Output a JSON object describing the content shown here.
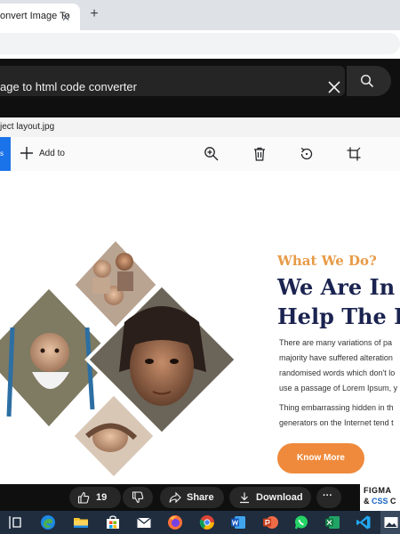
{
  "browser": {
    "tab_title": "onvert Image To",
    "close_glyph": "✕",
    "new_tab_glyph": "+"
  },
  "video_overlay": {
    "search_query": "age to html code converter",
    "clear_icon": "close-icon",
    "search_icon": "search-icon"
  },
  "viewer": {
    "file_name": "ject layout.jpg",
    "toolbar": {
      "edit_label": "s",
      "add_to_label": "Add to",
      "accent": "#1a73e8",
      "icons": [
        "zoom-in-icon",
        "delete-icon",
        "rotate-icon",
        "crop-icon"
      ]
    }
  },
  "image": {
    "eyebrow": "What We Do?",
    "heading_line1": "We Are In A",
    "heading_line2": "Help The Ho",
    "paragraph1": [
      "There are many variations of pa",
      "majority have suffered alteration",
      "randomised words which don't lo",
      "use a passage of Lorem Ipsum, y"
    ],
    "paragraph2": [
      "Thing embarrassing hidden in th",
      "generators on the Internet tend t"
    ],
    "button_label": "Know More",
    "colors": {
      "eyebrow": "#e89a46",
      "heading": "#1b2450",
      "button": "#ef8a3c"
    }
  },
  "video_actions": {
    "like_count": "19",
    "share_label": "Share",
    "download_label": "Download",
    "more_glyph": "···"
  },
  "promo_thumb": {
    "line1": "FIGMA",
    "line2_prefix": "& ",
    "line2_highlight": "CSS",
    "line2_suffix": " C"
  },
  "taskbar": {
    "icons": [
      "task-view-icon",
      "edge-icon",
      "file-explorer-icon",
      "store-icon",
      "mail-icon",
      "firefox-icon",
      "chrome-icon",
      "word-icon",
      "powerpoint-icon",
      "whatsapp-icon",
      "excel-icon",
      "vscode-icon",
      "photos-icon"
    ]
  }
}
